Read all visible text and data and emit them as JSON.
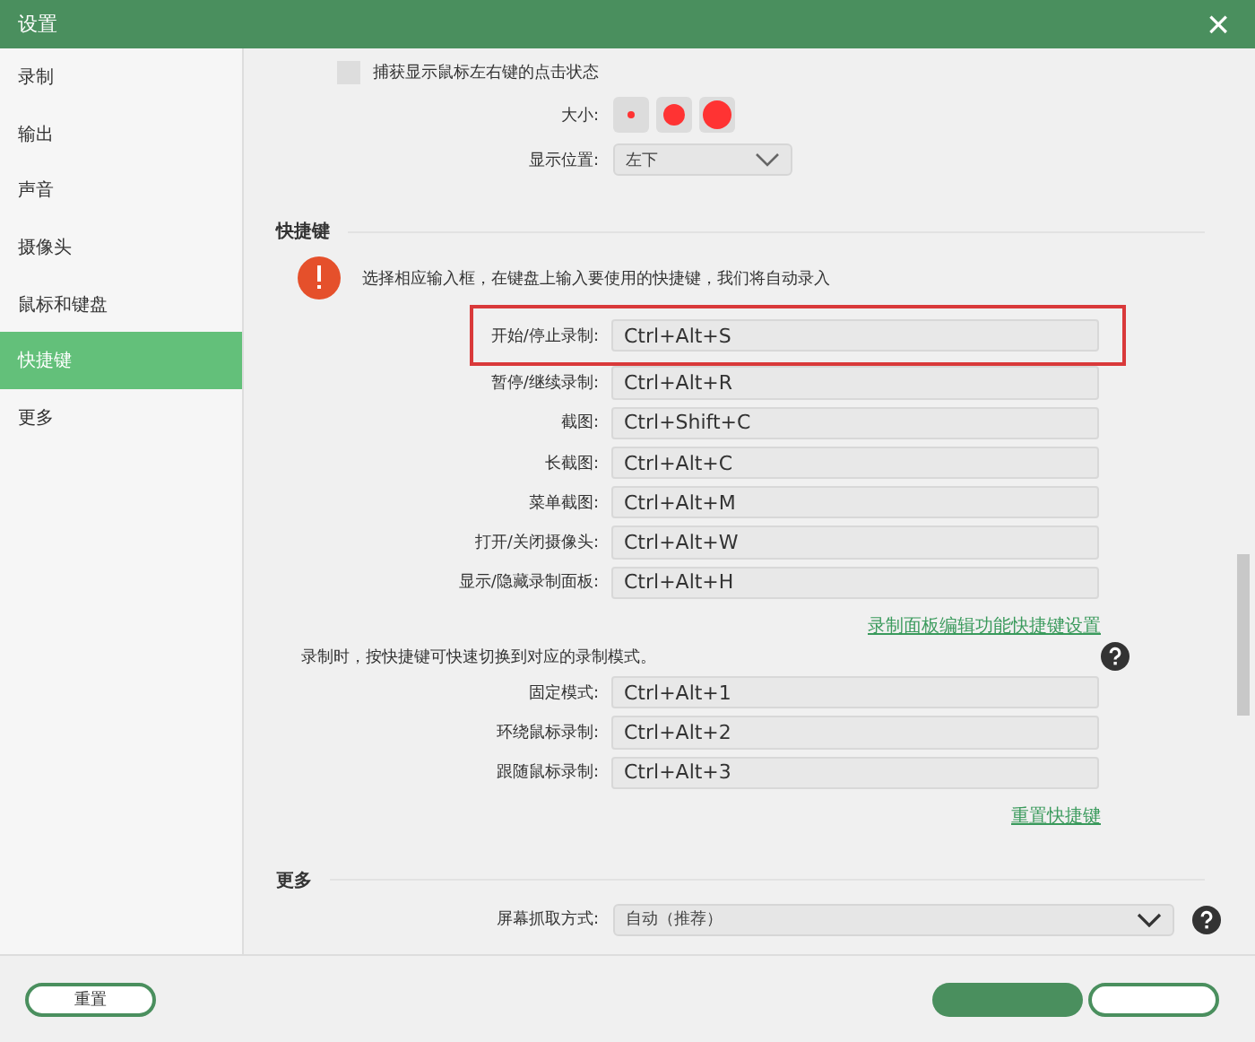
{
  "window": {
    "title": "设置",
    "close": "×"
  },
  "sidebar": {
    "items": [
      {
        "label": "录制",
        "selected": false
      },
      {
        "label": "输出",
        "selected": false
      },
      {
        "label": "声音",
        "selected": false
      },
      {
        "label": "摄像头",
        "selected": false
      },
      {
        "label": "鼠标和键盘",
        "selected": false
      },
      {
        "label": "快捷键",
        "selected": true
      },
      {
        "label": "更多",
        "selected": false
      }
    ]
  },
  "mouse": {
    "checkbox": {
      "label": "捕获显示鼠标左右键的点击状态",
      "checked": false
    },
    "size_label": "大小:",
    "sizes": [
      {
        "selected": false
      },
      {
        "selected": false
      },
      {
        "selected": false
      }
    ],
    "position_label": "显示位置:",
    "position_value": "左下"
  },
  "shortcuts": {
    "title": "快捷键",
    "notice": "选择相应输入框，在键盘上输入要使用的快捷键，我们将自动录入",
    "rows": [
      {
        "label": "开始/停止录制:",
        "value": "Ctrl+Alt+S",
        "highlighted": true
      },
      {
        "label": "暂停/继续录制:",
        "value": "Ctrl+Alt+R",
        "highlighted": false
      },
      {
        "label": "截图:",
        "value": "Ctrl+Shift+C",
        "highlighted": false
      },
      {
        "label": "长截图:",
        "value": "Ctrl+Alt+C",
        "highlighted": false
      },
      {
        "label": "菜单截图:",
        "value": "Ctrl+Alt+M",
        "highlighted": false
      },
      {
        "label": "打开/关闭摄像头:",
        "value": "Ctrl+Alt+W",
        "highlighted": false
      },
      {
        "label": "显示/隐藏录制面板:",
        "value": "Ctrl+Alt+H",
        "highlighted": false
      }
    ],
    "panel_link": "录制面板编辑功能快捷键设置",
    "mode_note": "录制时，按快捷键可快速切换到对应的录制模式。",
    "mode_rows": [
      {
        "label": "固定模式:",
        "value": "Ctrl+Alt+1"
      },
      {
        "label": "环绕鼠标录制:",
        "value": "Ctrl+Alt+2"
      },
      {
        "label": "跟随鼠标录制:",
        "value": "Ctrl+Alt+3"
      }
    ],
    "reset_link": "重置快捷键"
  },
  "more": {
    "title": "更多",
    "capture_label": "屏幕抓取方式:",
    "capture_value": "自动（推荐）"
  },
  "footer": {
    "buttons": [
      {
        "kind": "outline",
        "label": "重置"
      },
      {
        "kind": "primary"
      },
      {
        "kind": "outline"
      }
    ]
  }
}
